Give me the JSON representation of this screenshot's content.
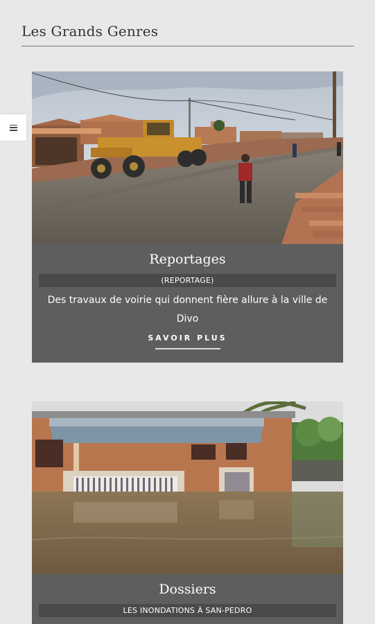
{
  "page": {
    "heading": "Les Grands Genres"
  },
  "cards": [
    {
      "title": "Reportages",
      "tag": "(REPORTAGE)",
      "description": "Des travaux de voirie qui donnent fière allure à la ville de Divo",
      "more_label": "SAVOIR PLUS",
      "image_icon": "road-works-photo"
    },
    {
      "title": "Dossiers",
      "tag": "LES INONDATIONS À SAN-PEDRO",
      "image_icon": "flooded-house-photo"
    }
  ],
  "colors": {
    "background": "#e8e8e8",
    "card": "#5e5e5e",
    "tag_bar": "#4a4a4a"
  }
}
